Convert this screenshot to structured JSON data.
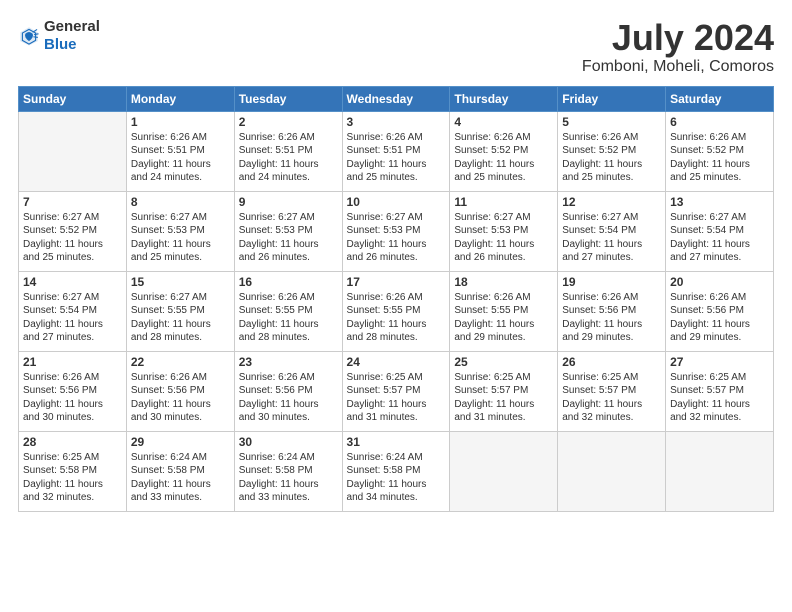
{
  "logo": {
    "general": "General",
    "blue": "Blue"
  },
  "title": "July 2024",
  "location": "Fomboni, Moheli, Comoros",
  "days_of_week": [
    "Sunday",
    "Monday",
    "Tuesday",
    "Wednesday",
    "Thursday",
    "Friday",
    "Saturday"
  ],
  "weeks": [
    [
      {
        "day": "",
        "empty": true
      },
      {
        "day": "1",
        "sunrise": "Sunrise: 6:26 AM",
        "sunset": "Sunset: 5:51 PM",
        "daylight": "Daylight: 11 hours and 24 minutes."
      },
      {
        "day": "2",
        "sunrise": "Sunrise: 6:26 AM",
        "sunset": "Sunset: 5:51 PM",
        "daylight": "Daylight: 11 hours and 24 minutes."
      },
      {
        "day": "3",
        "sunrise": "Sunrise: 6:26 AM",
        "sunset": "Sunset: 5:51 PM",
        "daylight": "Daylight: 11 hours and 25 minutes."
      },
      {
        "day": "4",
        "sunrise": "Sunrise: 6:26 AM",
        "sunset": "Sunset: 5:52 PM",
        "daylight": "Daylight: 11 hours and 25 minutes."
      },
      {
        "day": "5",
        "sunrise": "Sunrise: 6:26 AM",
        "sunset": "Sunset: 5:52 PM",
        "daylight": "Daylight: 11 hours and 25 minutes."
      },
      {
        "day": "6",
        "sunrise": "Sunrise: 6:26 AM",
        "sunset": "Sunset: 5:52 PM",
        "daylight": "Daylight: 11 hours and 25 minutes."
      }
    ],
    [
      {
        "day": "7",
        "sunrise": "Sunrise: 6:27 AM",
        "sunset": "Sunset: 5:52 PM",
        "daylight": "Daylight: 11 hours and 25 minutes."
      },
      {
        "day": "8",
        "sunrise": "Sunrise: 6:27 AM",
        "sunset": "Sunset: 5:53 PM",
        "daylight": "Daylight: 11 hours and 25 minutes."
      },
      {
        "day": "9",
        "sunrise": "Sunrise: 6:27 AM",
        "sunset": "Sunset: 5:53 PM",
        "daylight": "Daylight: 11 hours and 26 minutes."
      },
      {
        "day": "10",
        "sunrise": "Sunrise: 6:27 AM",
        "sunset": "Sunset: 5:53 PM",
        "daylight": "Daylight: 11 hours and 26 minutes."
      },
      {
        "day": "11",
        "sunrise": "Sunrise: 6:27 AM",
        "sunset": "Sunset: 5:53 PM",
        "daylight": "Daylight: 11 hours and 26 minutes."
      },
      {
        "day": "12",
        "sunrise": "Sunrise: 6:27 AM",
        "sunset": "Sunset: 5:54 PM",
        "daylight": "Daylight: 11 hours and 27 minutes."
      },
      {
        "day": "13",
        "sunrise": "Sunrise: 6:27 AM",
        "sunset": "Sunset: 5:54 PM",
        "daylight": "Daylight: 11 hours and 27 minutes."
      }
    ],
    [
      {
        "day": "14",
        "sunrise": "Sunrise: 6:27 AM",
        "sunset": "Sunset: 5:54 PM",
        "daylight": "Daylight: 11 hours and 27 minutes."
      },
      {
        "day": "15",
        "sunrise": "Sunrise: 6:27 AM",
        "sunset": "Sunset: 5:55 PM",
        "daylight": "Daylight: 11 hours and 28 minutes."
      },
      {
        "day": "16",
        "sunrise": "Sunrise: 6:26 AM",
        "sunset": "Sunset: 5:55 PM",
        "daylight": "Daylight: 11 hours and 28 minutes."
      },
      {
        "day": "17",
        "sunrise": "Sunrise: 6:26 AM",
        "sunset": "Sunset: 5:55 PM",
        "daylight": "Daylight: 11 hours and 28 minutes."
      },
      {
        "day": "18",
        "sunrise": "Sunrise: 6:26 AM",
        "sunset": "Sunset: 5:55 PM",
        "daylight": "Daylight: 11 hours and 29 minutes."
      },
      {
        "day": "19",
        "sunrise": "Sunrise: 6:26 AM",
        "sunset": "Sunset: 5:56 PM",
        "daylight": "Daylight: 11 hours and 29 minutes."
      },
      {
        "day": "20",
        "sunrise": "Sunrise: 6:26 AM",
        "sunset": "Sunset: 5:56 PM",
        "daylight": "Daylight: 11 hours and 29 minutes."
      }
    ],
    [
      {
        "day": "21",
        "sunrise": "Sunrise: 6:26 AM",
        "sunset": "Sunset: 5:56 PM",
        "daylight": "Daylight: 11 hours and 30 minutes."
      },
      {
        "day": "22",
        "sunrise": "Sunrise: 6:26 AM",
        "sunset": "Sunset: 5:56 PM",
        "daylight": "Daylight: 11 hours and 30 minutes."
      },
      {
        "day": "23",
        "sunrise": "Sunrise: 6:26 AM",
        "sunset": "Sunset: 5:56 PM",
        "daylight": "Daylight: 11 hours and 30 minutes."
      },
      {
        "day": "24",
        "sunrise": "Sunrise: 6:25 AM",
        "sunset": "Sunset: 5:57 PM",
        "daylight": "Daylight: 11 hours and 31 minutes."
      },
      {
        "day": "25",
        "sunrise": "Sunrise: 6:25 AM",
        "sunset": "Sunset: 5:57 PM",
        "daylight": "Daylight: 11 hours and 31 minutes."
      },
      {
        "day": "26",
        "sunrise": "Sunrise: 6:25 AM",
        "sunset": "Sunset: 5:57 PM",
        "daylight": "Daylight: 11 hours and 32 minutes."
      },
      {
        "day": "27",
        "sunrise": "Sunrise: 6:25 AM",
        "sunset": "Sunset: 5:57 PM",
        "daylight": "Daylight: 11 hours and 32 minutes."
      }
    ],
    [
      {
        "day": "28",
        "sunrise": "Sunrise: 6:25 AM",
        "sunset": "Sunset: 5:58 PM",
        "daylight": "Daylight: 11 hours and 32 minutes."
      },
      {
        "day": "29",
        "sunrise": "Sunrise: 6:24 AM",
        "sunset": "Sunset: 5:58 PM",
        "daylight": "Daylight: 11 hours and 33 minutes."
      },
      {
        "day": "30",
        "sunrise": "Sunrise: 6:24 AM",
        "sunset": "Sunset: 5:58 PM",
        "daylight": "Daylight: 11 hours and 33 minutes."
      },
      {
        "day": "31",
        "sunrise": "Sunrise: 6:24 AM",
        "sunset": "Sunset: 5:58 PM",
        "daylight": "Daylight: 11 hours and 34 minutes."
      },
      {
        "day": "",
        "empty": true
      },
      {
        "day": "",
        "empty": true
      },
      {
        "day": "",
        "empty": true
      }
    ]
  ]
}
